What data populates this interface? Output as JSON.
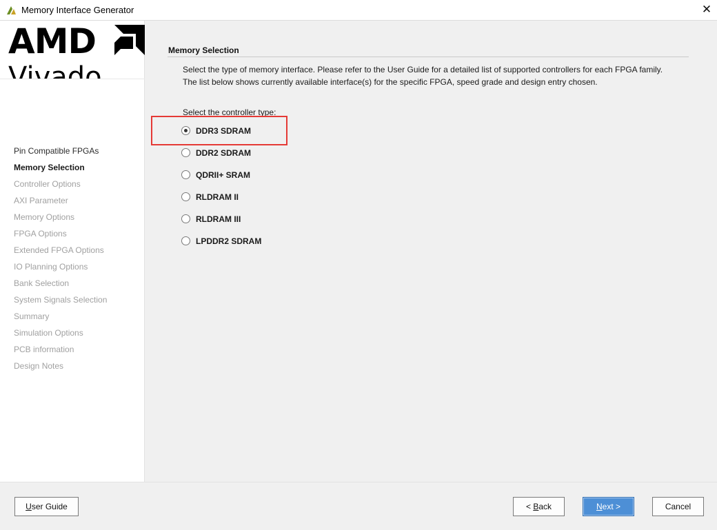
{
  "window": {
    "title": "Memory Interface Generator",
    "close_glyph": "✕",
    "app_icon": "vivado-icon"
  },
  "logo": {
    "brand": "AMD",
    "product": "Vivado"
  },
  "nav": {
    "items": [
      {
        "label": "Pin Compatible FPGAs",
        "state": "done"
      },
      {
        "label": "Memory Selection",
        "state": "active"
      },
      {
        "label": "Controller Options",
        "state": "pending"
      },
      {
        "label": "AXI Parameter",
        "state": "pending"
      },
      {
        "label": "Memory Options",
        "state": "pending"
      },
      {
        "label": "FPGA Options",
        "state": "pending"
      },
      {
        "label": "Extended FPGA Options",
        "state": "pending"
      },
      {
        "label": "IO Planning Options",
        "state": "pending"
      },
      {
        "label": "Bank Selection",
        "state": "pending"
      },
      {
        "label": "System Signals Selection",
        "state": "pending"
      },
      {
        "label": "Summary",
        "state": "pending"
      },
      {
        "label": "Simulation Options",
        "state": "pending"
      },
      {
        "label": "PCB information",
        "state": "pending"
      },
      {
        "label": "Design Notes",
        "state": "pending"
      }
    ]
  },
  "main": {
    "section_title": "Memory Selection",
    "description_line1": "Select the type of memory interface. Please refer to the User Guide for a detailed list of supported controllers for each FPGA family.",
    "description_line2": "The list below shows currently available interface(s) for the specific FPGA, speed grade and design entry chosen.",
    "select_label": "Select the controller type:",
    "options": [
      {
        "label": "DDR3 SDRAM",
        "selected": true
      },
      {
        "label": "DDR2 SDRAM",
        "selected": false
      },
      {
        "label": "QDRII+ SRAM",
        "selected": false
      },
      {
        "label": "RLDRAM II",
        "selected": false
      },
      {
        "label": "RLDRAM III",
        "selected": false
      },
      {
        "label": "LPDDR2 SDRAM",
        "selected": false
      }
    ],
    "highlight_color": "#e53935"
  },
  "footer": {
    "user_guide": {
      "pre": "",
      "key": "U",
      "post": "ser Guide"
    },
    "back": {
      "pre": "< ",
      "key": "B",
      "post": "ack"
    },
    "next": {
      "pre": "",
      "key": "N",
      "post": "ext >"
    },
    "cancel": "Cancel"
  },
  "colors": {
    "accent": "#4d8fd6",
    "disabled_text": "#a0a0a0"
  }
}
